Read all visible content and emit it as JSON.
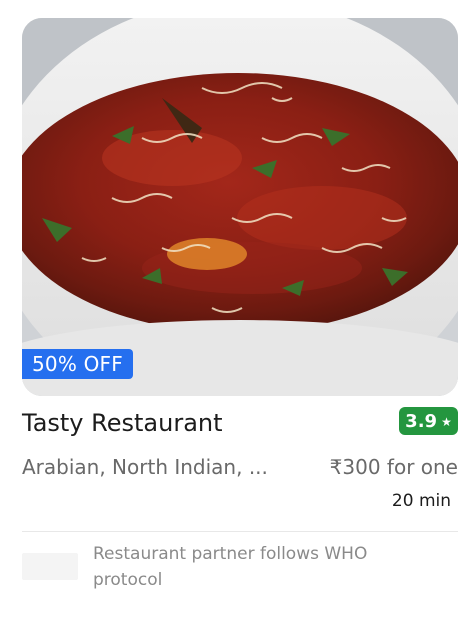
{
  "restaurant": {
    "name": "Tasty Restaurant",
    "rating": "3.9",
    "rating_icon": "star-icon",
    "cuisines": "Arabian, North Indian, ...",
    "price": "₹300 for one",
    "delivery_time": "20 min"
  },
  "offer": {
    "label": "50% OFF",
    "color": "#256fef"
  },
  "safety": {
    "text": "Restaurant partner follows WHO protocol",
    "logo_icon": "who-logo"
  },
  "colors": {
    "rating_badge": "#24963f",
    "offer_badge": "#256fef",
    "secondary_text": "#696969"
  }
}
